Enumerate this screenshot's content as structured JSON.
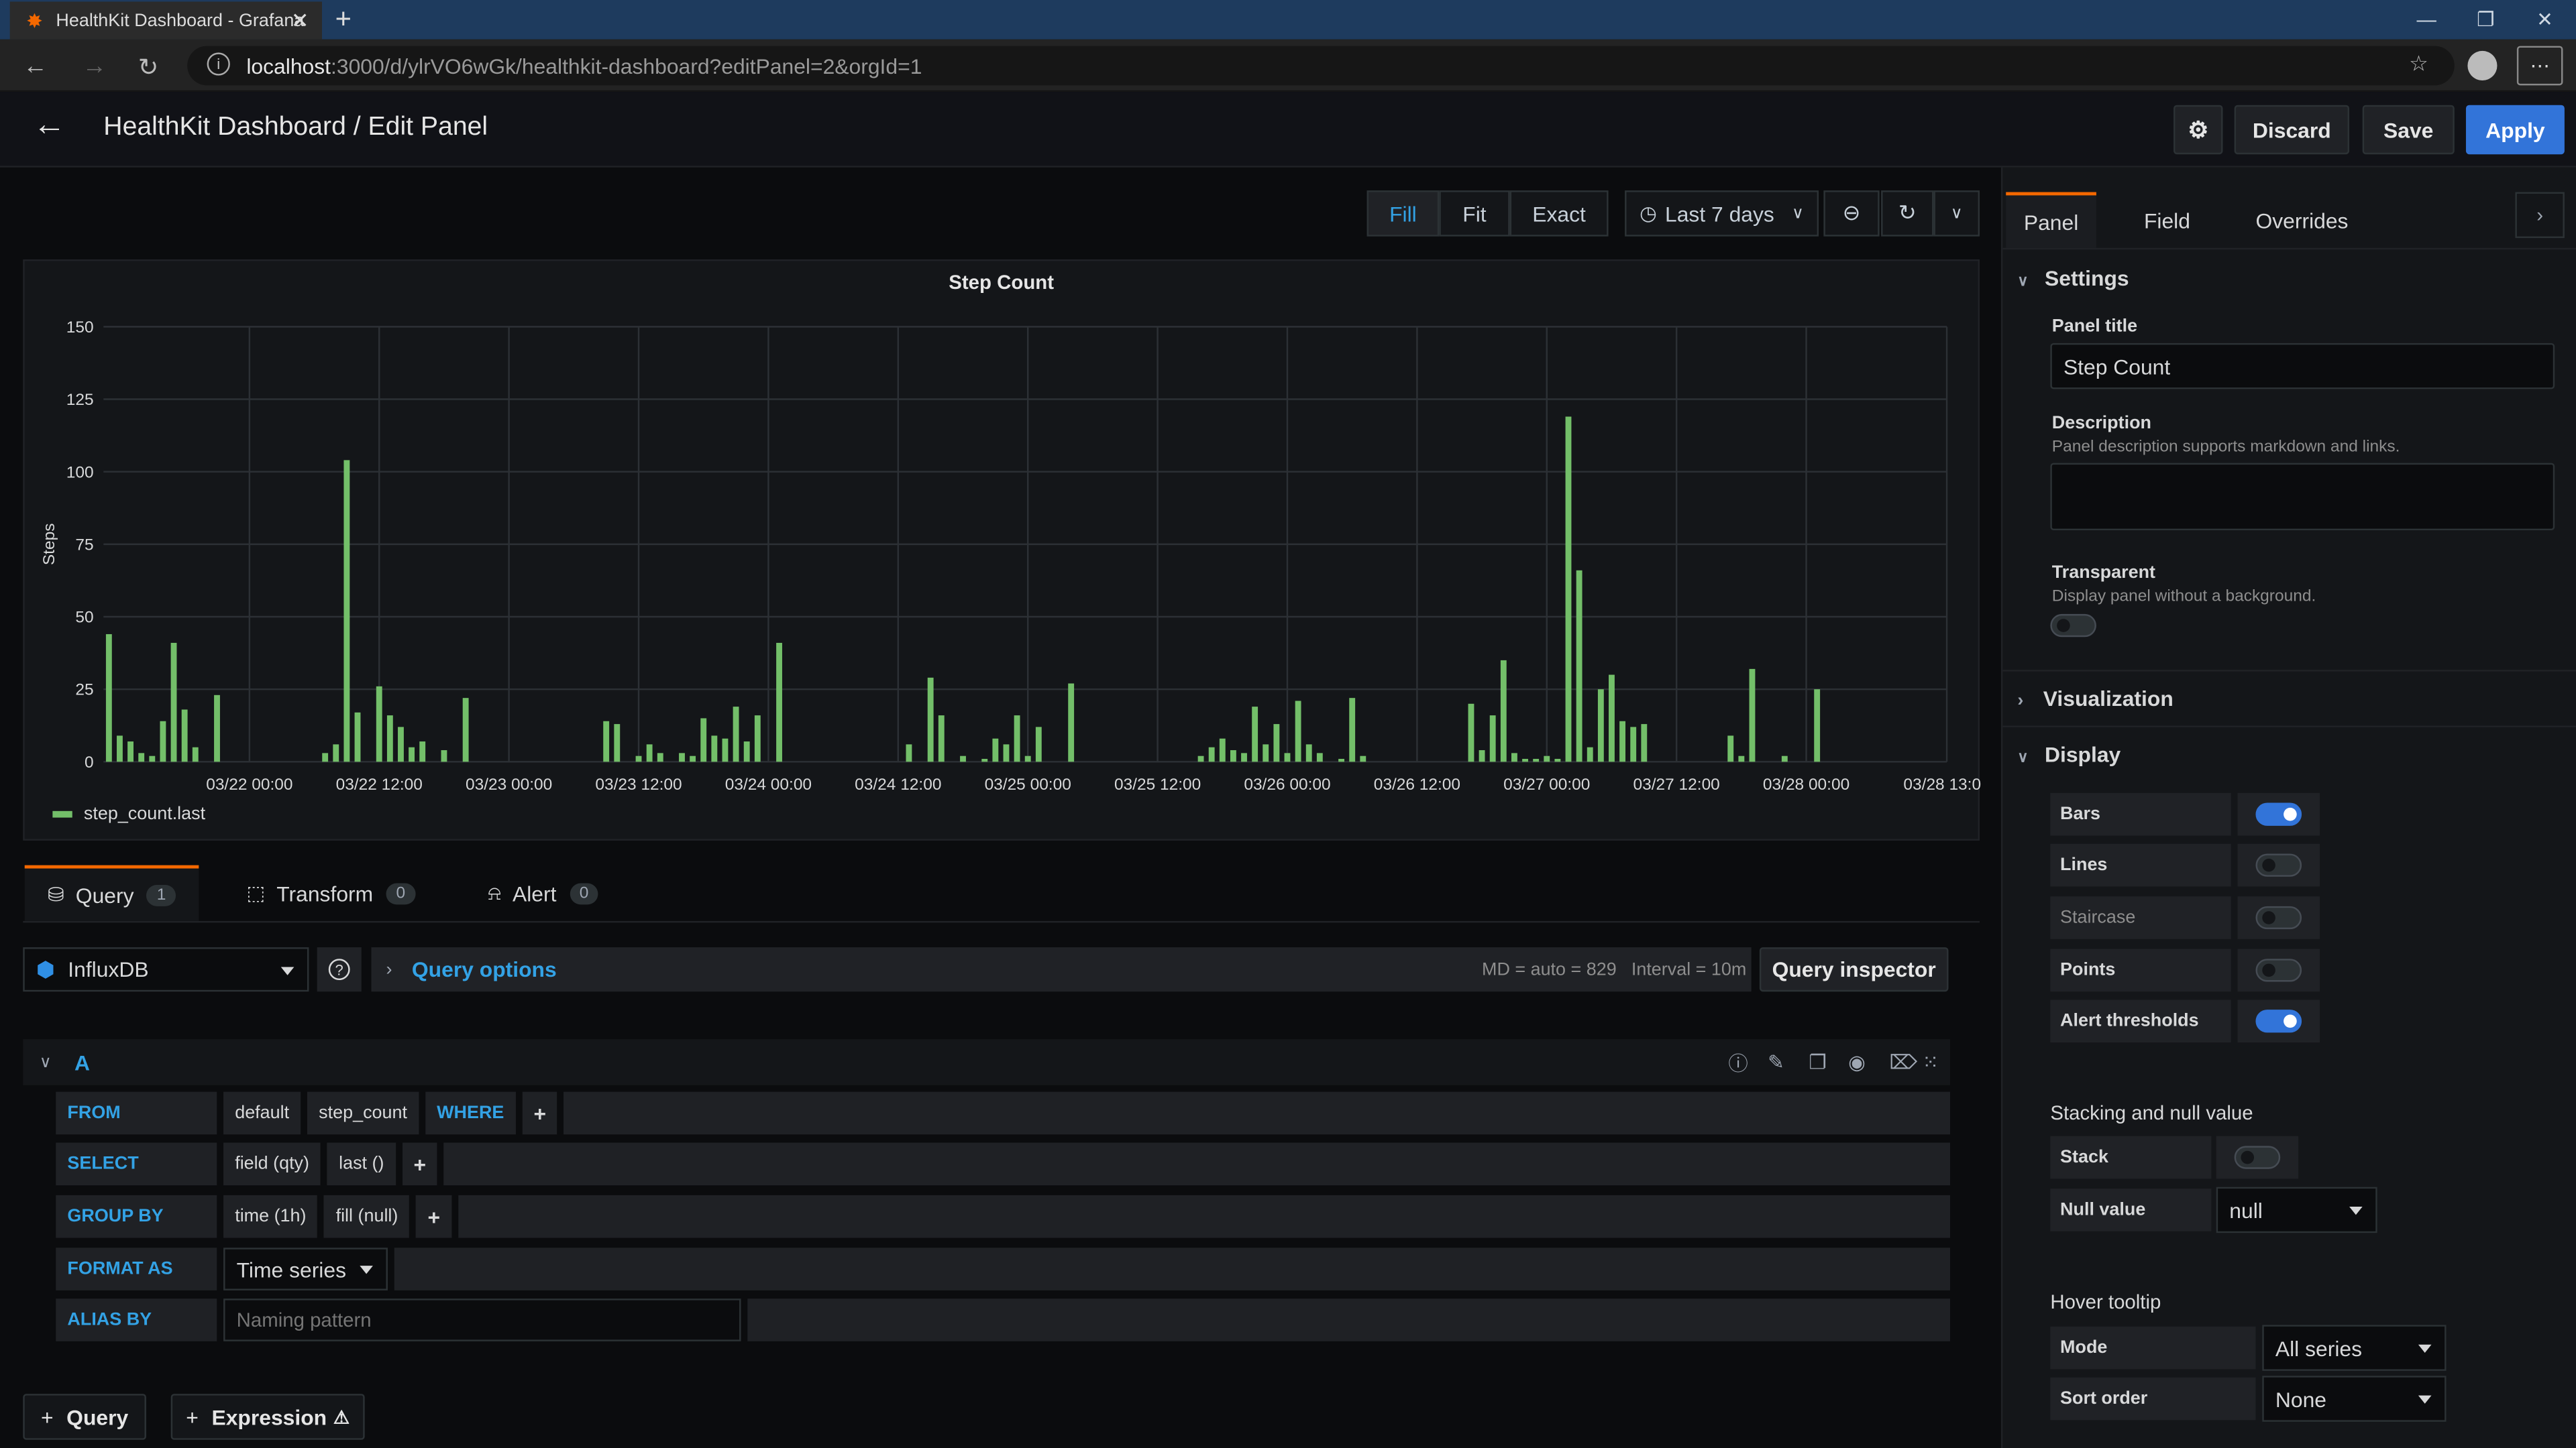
{
  "browser": {
    "tab_title": "HealthKit Dashboard - Grafana",
    "url_host": "localhost",
    "url_rest": ":3000/d/ylrVO6wGk/healthkit-dashboard?editPanel=2&orgId=1"
  },
  "header": {
    "title": "HealthKit Dashboard / Edit Panel",
    "discard_label": "Discard",
    "save_label": "Save",
    "apply_label": "Apply"
  },
  "toolbar": {
    "fill_label": "Fill",
    "fit_label": "Fit",
    "exact_label": "Exact",
    "time_range": "Last 7 days"
  },
  "chart_data": {
    "type": "bar",
    "title": "Step Count",
    "xlabel": "",
    "ylabel": "Steps",
    "ylim": [
      0,
      150
    ],
    "y_ticks": [
      0,
      25,
      50,
      75,
      100,
      125,
      150
    ],
    "x_tick_labels": [
      "03/22 00:00",
      "03/22 12:00",
      "03/23 00:00",
      "03/23 12:00",
      "03/24 00:00",
      "03/24 12:00",
      "03/25 00:00",
      "03/25 12:00",
      "03/26 00:00",
      "03/26 12:00",
      "03/27 00:00",
      "03/27 12:00",
      "03/28 00:00",
      "03/28 13:00"
    ],
    "x_range_hours": [
      -13.5,
      157
    ],
    "grid": true,
    "legend": "bottom-left",
    "series": [
      {
        "name": "step_count.last",
        "color": "#73bf69",
        "points": [
          [
            -13,
            44
          ],
          [
            -12,
            9
          ],
          [
            -11,
            7
          ],
          [
            -10,
            3
          ],
          [
            -9,
            2
          ],
          [
            -8,
            14
          ],
          [
            -7,
            41
          ],
          [
            -6,
            18
          ],
          [
            -5,
            5
          ],
          [
            -3,
            23
          ],
          [
            7,
            3
          ],
          [
            8,
            6
          ],
          [
            9,
            104
          ],
          [
            10,
            17
          ],
          [
            12,
            26
          ],
          [
            13,
            16
          ],
          [
            14,
            12
          ],
          [
            15,
            5
          ],
          [
            16,
            7
          ],
          [
            18,
            4
          ],
          [
            20,
            22
          ],
          [
            33,
            14
          ],
          [
            34,
            13
          ],
          [
            36,
            2
          ],
          [
            37,
            6
          ],
          [
            38,
            3
          ],
          [
            40,
            3
          ],
          [
            41,
            2
          ],
          [
            42,
            15
          ],
          [
            43,
            9
          ],
          [
            44,
            8
          ],
          [
            45,
            19
          ],
          [
            46,
            7
          ],
          [
            47,
            16
          ],
          [
            49,
            41
          ],
          [
            61,
            6
          ],
          [
            63,
            29
          ],
          [
            64,
            16
          ],
          [
            66,
            2
          ],
          [
            68,
            1
          ],
          [
            69,
            8
          ],
          [
            70,
            6
          ],
          [
            71,
            16
          ],
          [
            72,
            2
          ],
          [
            73,
            12
          ],
          [
            76,
            27
          ],
          [
            88,
            2
          ],
          [
            89,
            5
          ],
          [
            90,
            8
          ],
          [
            91,
            4
          ],
          [
            92,
            3
          ],
          [
            93,
            19
          ],
          [
            94,
            6
          ],
          [
            95,
            13
          ],
          [
            96,
            3
          ],
          [
            97,
            21
          ],
          [
            98,
            6
          ],
          [
            99,
            3
          ],
          [
            101,
            1
          ],
          [
            102,
            22
          ],
          [
            103,
            2
          ],
          [
            113,
            20
          ],
          [
            114,
            4
          ],
          [
            115,
            16
          ],
          [
            116,
            35
          ],
          [
            117,
            3
          ],
          [
            118,
            1
          ],
          [
            119,
            1
          ],
          [
            120,
            2
          ],
          [
            121,
            1
          ],
          [
            122,
            119
          ],
          [
            123,
            66
          ],
          [
            124,
            5
          ],
          [
            125,
            25
          ],
          [
            126,
            30
          ],
          [
            127,
            14
          ],
          [
            128,
            12
          ],
          [
            129,
            13
          ],
          [
            137,
            9
          ],
          [
            138,
            2
          ],
          [
            139,
            32
          ],
          [
            142,
            2
          ],
          [
            145,
            25
          ]
        ]
      }
    ]
  },
  "query_tabs": {
    "query_label": "Query",
    "query_count": "1",
    "transform_label": "Transform",
    "transform_count": "0",
    "alert_label": "Alert",
    "alert_count": "0"
  },
  "query_bar": {
    "datasource": "InfluxDB",
    "options_label": "Query options",
    "md": "MD = auto = 829",
    "interval": "Interval = 10m",
    "inspector_label": "Query inspector"
  },
  "query_editor": {
    "ref_id": "A",
    "from_label": "FROM",
    "from_policy": "default",
    "from_measurement": "step_count",
    "where_label": "WHERE",
    "select_label": "SELECT",
    "select_field": "field (qty)",
    "select_fn": "last ()",
    "group_label": "GROUP BY",
    "group_time": "time (1h)",
    "group_fill": "fill (null)",
    "format_label": "FORMAT AS",
    "format_value": "Time series",
    "alias_label": "ALIAS BY",
    "alias_placeholder": "Naming pattern",
    "add_query": "Query",
    "add_expression": "Expression"
  },
  "sidebar": {
    "tab_panel": "Panel",
    "tab_field": "Field",
    "tab_overrides": "Overrides",
    "settings_header": "Settings",
    "panel_title_label": "Panel title",
    "panel_title_value": "Step Count",
    "description_label": "Description",
    "description_hint": "Panel description supports markdown and links.",
    "transparent_label": "Transparent",
    "transparent_hint": "Display panel without a background.",
    "visualization_header": "Visualization",
    "display_header": "Display",
    "display_options": [
      {
        "label": "Bars",
        "on": true
      },
      {
        "label": "Lines",
        "on": false
      },
      {
        "label": "Staircase",
        "on": false
      },
      {
        "label": "Points",
        "on": false
      },
      {
        "label": "Alert thresholds",
        "on": true
      }
    ],
    "stacking_header": "Stacking and null value",
    "stack_label": "Stack",
    "null_value_label": "Null value",
    "null_value": "null",
    "hover_header": "Hover tooltip",
    "mode_label": "Mode",
    "mode_value": "All series",
    "sort_label": "Sort order",
    "sort_value": "None"
  }
}
